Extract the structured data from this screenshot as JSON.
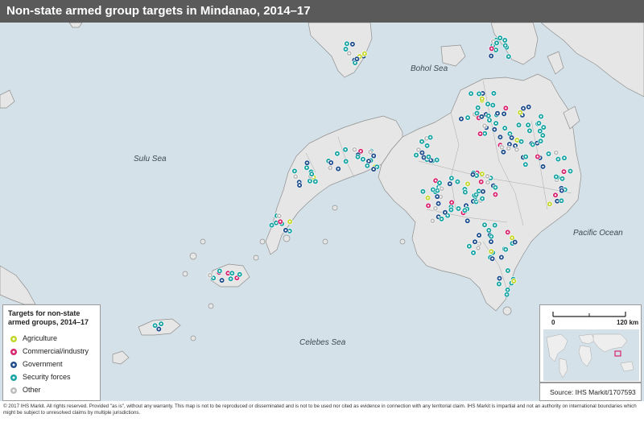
{
  "title": "Non-state armed group targets in Mindanao, 2014–17",
  "sea_labels": {
    "bohol": "Bohol Sea",
    "sulu": "Sulu Sea",
    "celebes": "Celebes Sea",
    "pacific": "Pacific Ocean"
  },
  "legend": {
    "title": "Targets for non-state armed groups, 2014–17",
    "items": [
      {
        "label": "Agriculture",
        "color": "#c3d62b"
      },
      {
        "label": "Commercial/industry",
        "color": "#d6246e"
      },
      {
        "label": "Government",
        "color": "#1f4e8c"
      },
      {
        "label": "Security forces",
        "color": "#17a3a3"
      },
      {
        "label": "Other",
        "color": "#bdbdbd"
      }
    ]
  },
  "scale": {
    "zero": "0",
    "max": "120 km"
  },
  "source": "Source: IHS Markit/1707593",
  "footer": "© 2017 IHS Markit. All rights reserved. Provided \"as is\", without any warranty. This map is not to be reproduced or disseminated and is not to be used nor cited as evidence in connection with any territorial claim. IHS Markit is impartial and not an authority on international boundaries which might be subject to unresolved claims by multiple jurisdictions."
}
